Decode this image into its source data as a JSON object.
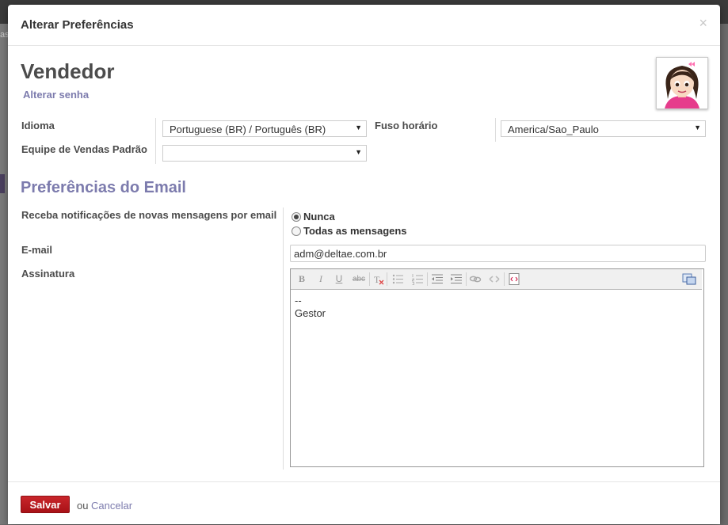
{
  "dialog": {
    "title": "Alterar Preferências",
    "close_symbol": "×"
  },
  "backdrop": {
    "fragment_text": "as"
  },
  "user": {
    "name": "Vendedor",
    "change_password_link": "Alterar senha",
    "avatar": "cartoon-girl-avatar"
  },
  "fields": {
    "language": {
      "label": "Idioma",
      "value": "Portuguese (BR) / Português (BR)"
    },
    "default_sales_team": {
      "label": "Equipe de Vendas Padrão",
      "value": ""
    },
    "timezone": {
      "label": "Fuso horário",
      "value": "America/Sao_Paulo"
    }
  },
  "email_prefs": {
    "section_title": "Preferências do Email",
    "notifications_label": "Receba notificações de novas mensagens por email",
    "options": [
      {
        "label": "Nunca",
        "checked": true
      },
      {
        "label": "Todas as mensagens",
        "checked": false
      }
    ],
    "email_label": "E-mail",
    "email_value": "adm@deltae.com.br",
    "signature_label": "Assinatura",
    "signature_lines": [
      "--",
      "Gestor"
    ]
  },
  "editor_toolbar": {
    "icons": [
      "bold-icon",
      "italic-icon",
      "underline-icon",
      "strikethrough-icon",
      "remove-format-icon",
      "unordered-list-icon",
      "ordered-list-icon",
      "outdent-icon",
      "indent-icon",
      "link-icon",
      "unlink-icon",
      "source-code-icon",
      "html-view-icon"
    ],
    "bold_glyph": "B",
    "italic_glyph": "I",
    "underline_glyph": "U",
    "strike_glyph": "abc"
  },
  "footer": {
    "save_label": "Salvar",
    "or_text": "ou",
    "cancel_label": "Cancelar"
  },
  "colors": {
    "accent": "#7c7bad",
    "save_button": "#b8161b"
  }
}
